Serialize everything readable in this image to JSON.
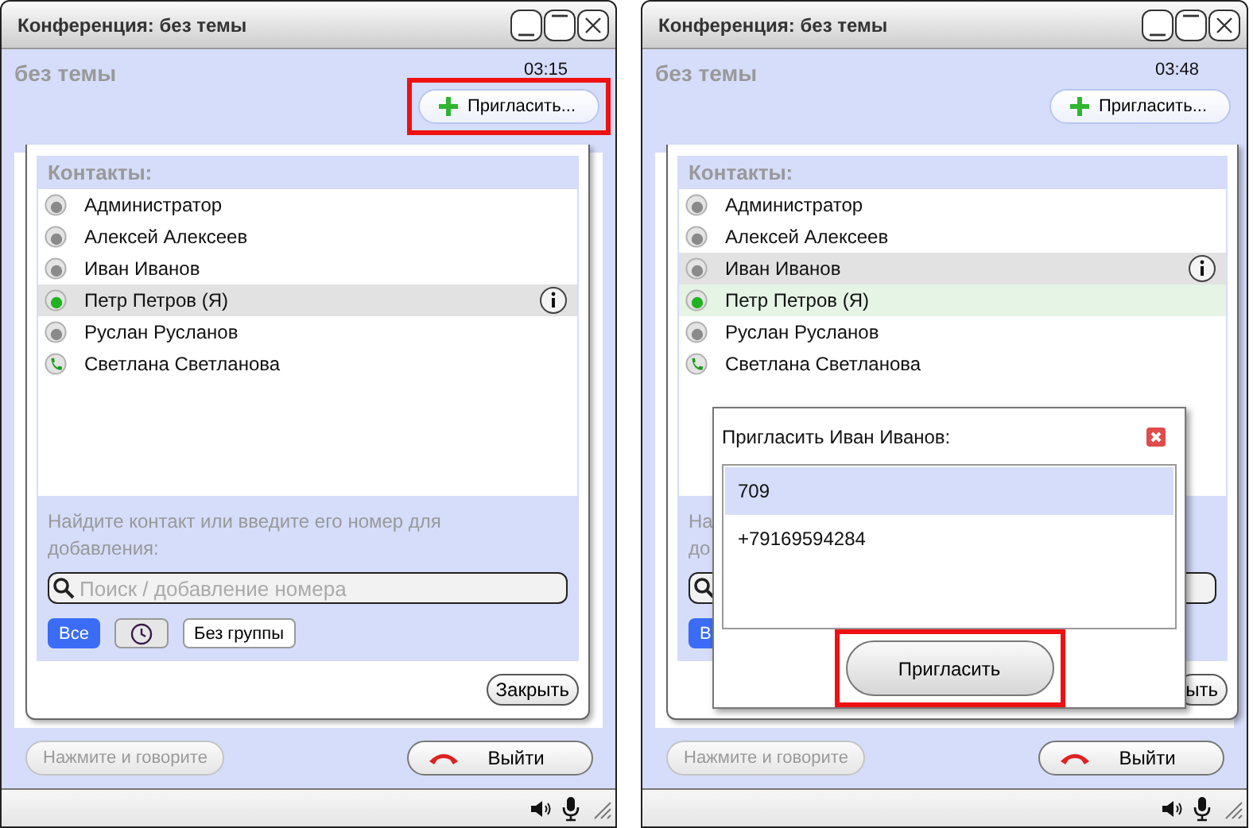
{
  "windows": [
    {
      "title": "Конференция: без темы",
      "subject": "без темы",
      "time": "03:15",
      "invite_button": {
        "label": "Пригласить...",
        "highlighted": true
      },
      "contacts_panel": {
        "heading": "Контакты:",
        "contacts": [
          {
            "name": "Администратор",
            "kind": "offline",
            "selected": false,
            "highlighted": false
          },
          {
            "name": "Алексей Алексеев",
            "kind": "offline",
            "selected": false,
            "highlighted": false
          },
          {
            "name": "Иван Иванов",
            "kind": "offline",
            "selected": false,
            "highlighted": false
          },
          {
            "name": "Петр Петров (Я)",
            "kind": "online",
            "selected": true,
            "highlighted": false
          },
          {
            "name": "Руслан Русланов",
            "kind": "offline",
            "selected": false,
            "highlighted": false
          },
          {
            "name": "Светлана Светланова",
            "kind": "call",
            "selected": false,
            "highlighted": false
          }
        ],
        "hint_lines": [
          "Найдите контакт или введите его номер для",
          "добавления:"
        ],
        "search": {
          "placeholder": "Поиск / добавление номера"
        },
        "filters": [
          {
            "kind": "text",
            "label": "Все",
            "selected": true
          },
          {
            "kind": "clock",
            "selected": false
          },
          {
            "kind": "text",
            "label": "Без группы",
            "selected": false
          }
        ],
        "close_button": "Закрыть"
      },
      "talk_button": {
        "label": "Нажмите и говорите",
        "disabled": true
      },
      "leave_button": "Выйти"
    },
    {
      "title": "Конференция: без темы",
      "subject": "без темы",
      "time": "03:48",
      "invite_button": {
        "label": "Пригласить...",
        "highlighted": false
      },
      "contacts_panel": {
        "heading": "Контакты:",
        "contacts": [
          {
            "name": "Администратор",
            "kind": "offline",
            "selected": false,
            "highlighted": false
          },
          {
            "name": "Алексей Алексеев",
            "kind": "offline",
            "selected": false,
            "highlighted": false
          },
          {
            "name": "Иван Иванов",
            "kind": "offline",
            "selected": true,
            "highlighted": false
          },
          {
            "name": "Петр Петров (Я)",
            "kind": "online",
            "selected": false,
            "highlighted": true
          },
          {
            "name": "Руслан Русланов",
            "kind": "offline",
            "selected": false,
            "highlighted": false
          },
          {
            "name": "Светлана Светланова",
            "kind": "call",
            "selected": false,
            "highlighted": false
          }
        ],
        "hint_lines": [
          "На",
          "до"
        ],
        "filters": [
          {
            "kind": "text",
            "label": "В",
            "selected": true
          }
        ],
        "close_button": "ыть"
      },
      "invite_dialog": {
        "title": "Пригласить Иван Иванов:",
        "numbers": [
          {
            "label": "709",
            "selected": true
          },
          {
            "label": "+79169594284",
            "selected": false
          }
        ],
        "invite_button": {
          "label": "Пригласить",
          "highlighted": true
        }
      },
      "talk_button": {
        "label": "Нажмите и говорите",
        "disabled": true
      },
      "leave_button": "Выйти"
    }
  ]
}
